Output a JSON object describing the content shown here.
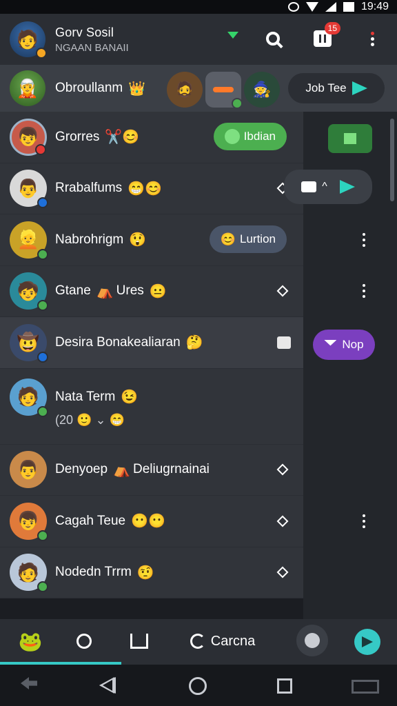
{
  "status_bar": {
    "time": "19:49"
  },
  "header": {
    "title": "Gorv Sosil",
    "subtitle": "NGAAN BANAII",
    "notification_count": "15"
  },
  "pinned": {
    "name": "Obroullanm",
    "action_label": "Job Tee"
  },
  "chats": [
    {
      "name": "Grorres",
      "tag": "Ibdian",
      "tag_color": "#4caf50"
    },
    {
      "name": "Rrabalfums"
    },
    {
      "name": "Nabrohrigm",
      "tag": "Lurtion",
      "tag_color": "#4a5568"
    },
    {
      "name": "Gtane",
      "name_suffix": "Ures"
    },
    {
      "name": "Desira Bonakealiaran"
    },
    {
      "name": "Nata Term",
      "subline": "(20"
    },
    {
      "name": "Denyoep",
      "name_suffix": "Deliugrnainai"
    },
    {
      "name": "Cagah Teue"
    },
    {
      "name": "Nodedn Trrm"
    }
  ],
  "floating": {
    "nop_label": "Nop"
  },
  "bottom_nav": {
    "chat_label": "Carcna"
  },
  "colors": {
    "accent": "#36c9c6",
    "online_green": "#4caf50",
    "purple": "#7b3fbf",
    "badge_red": "#e53935"
  }
}
